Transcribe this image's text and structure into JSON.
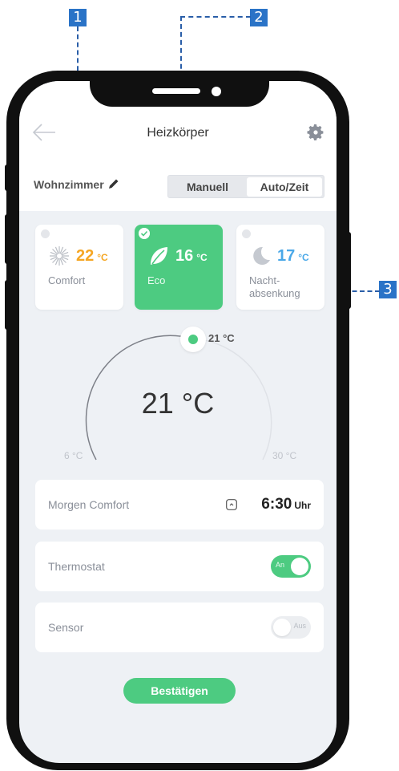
{
  "callouts": [
    "1",
    "2",
    "3"
  ],
  "header": {
    "title": "Heizkörper"
  },
  "room": {
    "name": "Wohnzimmer"
  },
  "mode_switch": {
    "manual": "Manuell",
    "auto": "Auto/Zeit"
  },
  "presets": [
    {
      "temp": "22",
      "unit": "°C",
      "label": "Comfort",
      "color": "#f5a623",
      "icon": "sun-icon",
      "selected": false
    },
    {
      "temp": "16",
      "unit": "°C",
      "label": "Eco",
      "color": "#ffffff",
      "icon": "leaf-icon",
      "selected": true
    },
    {
      "temp": "17",
      "unit": "°C",
      "label_line1": "Nacht-",
      "label_line2": "absenkung",
      "color": "#4aa8e8",
      "icon": "moon-icon",
      "selected": false
    }
  ],
  "dial": {
    "current": "21 °C",
    "setpoint": "21 °C",
    "min": "6 °C",
    "max": "30 °C"
  },
  "schedule": {
    "label": "Morgen Comfort",
    "time": "6:30",
    "unit": "Uhr"
  },
  "thermostat": {
    "label": "Thermostat",
    "state": "An",
    "on": true
  },
  "sensor": {
    "label": "Sensor",
    "state": "Aus",
    "on": false
  },
  "confirm_label": "Bestätigen",
  "colors": {
    "accent": "#4dcb81",
    "callout": "#2a73c7",
    "background": "#eef1f5"
  }
}
